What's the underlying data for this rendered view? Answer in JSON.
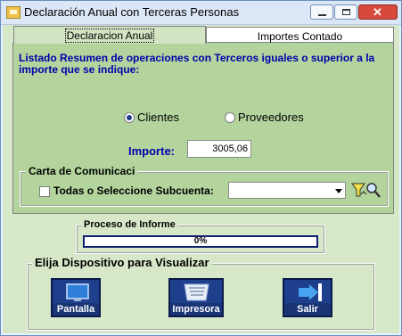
{
  "window": {
    "title": "Declaración Anual con Terceras Personas",
    "controls": {
      "minimize": "minimize",
      "maximize": "maximize",
      "close": "close"
    }
  },
  "tabs": [
    {
      "label": "Declaracion Anual",
      "active": true
    },
    {
      "label": "Importes Contado",
      "active": false
    }
  ],
  "heading": "Listado Resumen de operaciones con Terceros iguales o superior a la importe que se indique:",
  "radios": [
    {
      "label": "Clientes",
      "selected": true
    },
    {
      "label": "Proveedores",
      "selected": false
    }
  ],
  "importe": {
    "label": "Importe:",
    "value": "3005,06"
  },
  "carta": {
    "legend": "Carta de Comunicaci",
    "checkbox_label": "Todas o Seleccione Subcuenta:",
    "checked": false,
    "select_value": ""
  },
  "proceso": {
    "legend": "Proceso de Informe",
    "progress_text": "0%",
    "progress_value": 0.0
  },
  "dispositivo": {
    "legend": "Elija Dispositivo para Visualizar",
    "buttons": [
      {
        "label": "Pantalla",
        "icon": "monitor-icon"
      },
      {
        "label": "Impresora",
        "icon": "printer-icon"
      },
      {
        "label": "Salir",
        "icon": "exit-door-icon"
      }
    ]
  },
  "colors": {
    "client_bg": "#d7e8c9",
    "panel_bg": "#b3d49d",
    "heading_text": "#0000aa",
    "button_bg": "#1e3f8c",
    "progress_border": "#0f1e6e"
  }
}
